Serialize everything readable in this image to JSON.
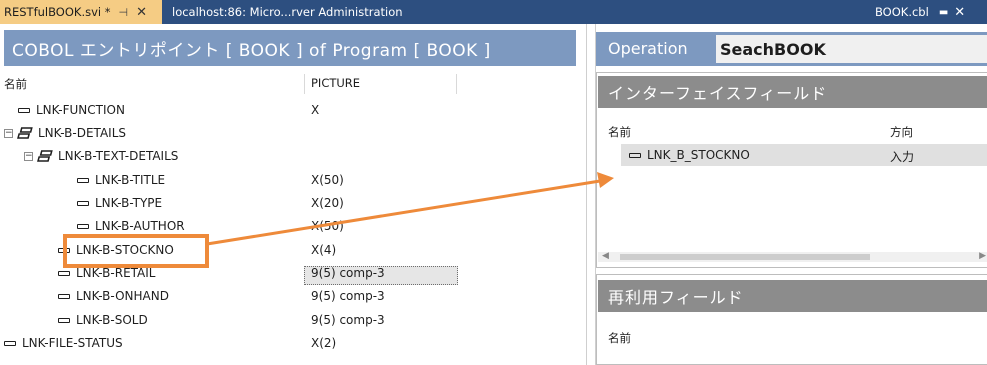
{
  "tabs": {
    "active": {
      "label": "RESTfulBOOK.svi *",
      "pin": "⊣",
      "close": "✕"
    },
    "inactive": {
      "label": "localhost:86: Micro...rver Administration"
    },
    "right": {
      "label": "BOOK.cbl",
      "pin": "▬",
      "close": "✕"
    }
  },
  "left": {
    "header": "COBOL エントリポイント [ BOOK ] of Program [ BOOK ]",
    "columns": {
      "name": "名前",
      "picture": "PICTURE"
    },
    "rows": [
      {
        "label": "LNK-FUNCTION",
        "picture": "X"
      },
      {
        "label": "LNK-B-DETAILS",
        "picture": ""
      },
      {
        "label": "LNK-B-TEXT-DETAILS",
        "picture": ""
      },
      {
        "label": "LNK-B-TITLE",
        "picture": "X(50)"
      },
      {
        "label": "LNK-B-TYPE",
        "picture": "X(20)"
      },
      {
        "label": "LNK-B-AUTHOR",
        "picture": "X(50)"
      },
      {
        "label": "LNK-B-STOCKNO",
        "picture": "X(4)"
      },
      {
        "label": "LNK-B-RETAIL",
        "picture": "9(5) comp-3"
      },
      {
        "label": "LNK-B-ONHAND",
        "picture": "9(5) comp-3"
      },
      {
        "label": "LNK-B-SOLD",
        "picture": "9(5) comp-3"
      },
      {
        "label": "LNK-FILE-STATUS",
        "picture": "X(2)"
      }
    ],
    "expander_symbol": "−"
  },
  "right": {
    "operation_label": "Operation",
    "operation_value": "SeachBOOK",
    "interface_title": "インターフェイスフィールド",
    "columns": {
      "name": "名前",
      "direction": "方向"
    },
    "interface_row": {
      "label": "LNK_B_STOCKNO",
      "direction": "入力"
    },
    "reuse_title": "再利用フィールド",
    "reuse_column": "名前",
    "scroll_left": "◀",
    "scroll_right": "▶"
  },
  "colors": {
    "tab_strip": "#2d4f80",
    "active_tab": "#f5cc84",
    "header_blue": "#7d99c0",
    "section_gray": "#8c8c8c",
    "annotation_orange": "#ee8a3a"
  }
}
